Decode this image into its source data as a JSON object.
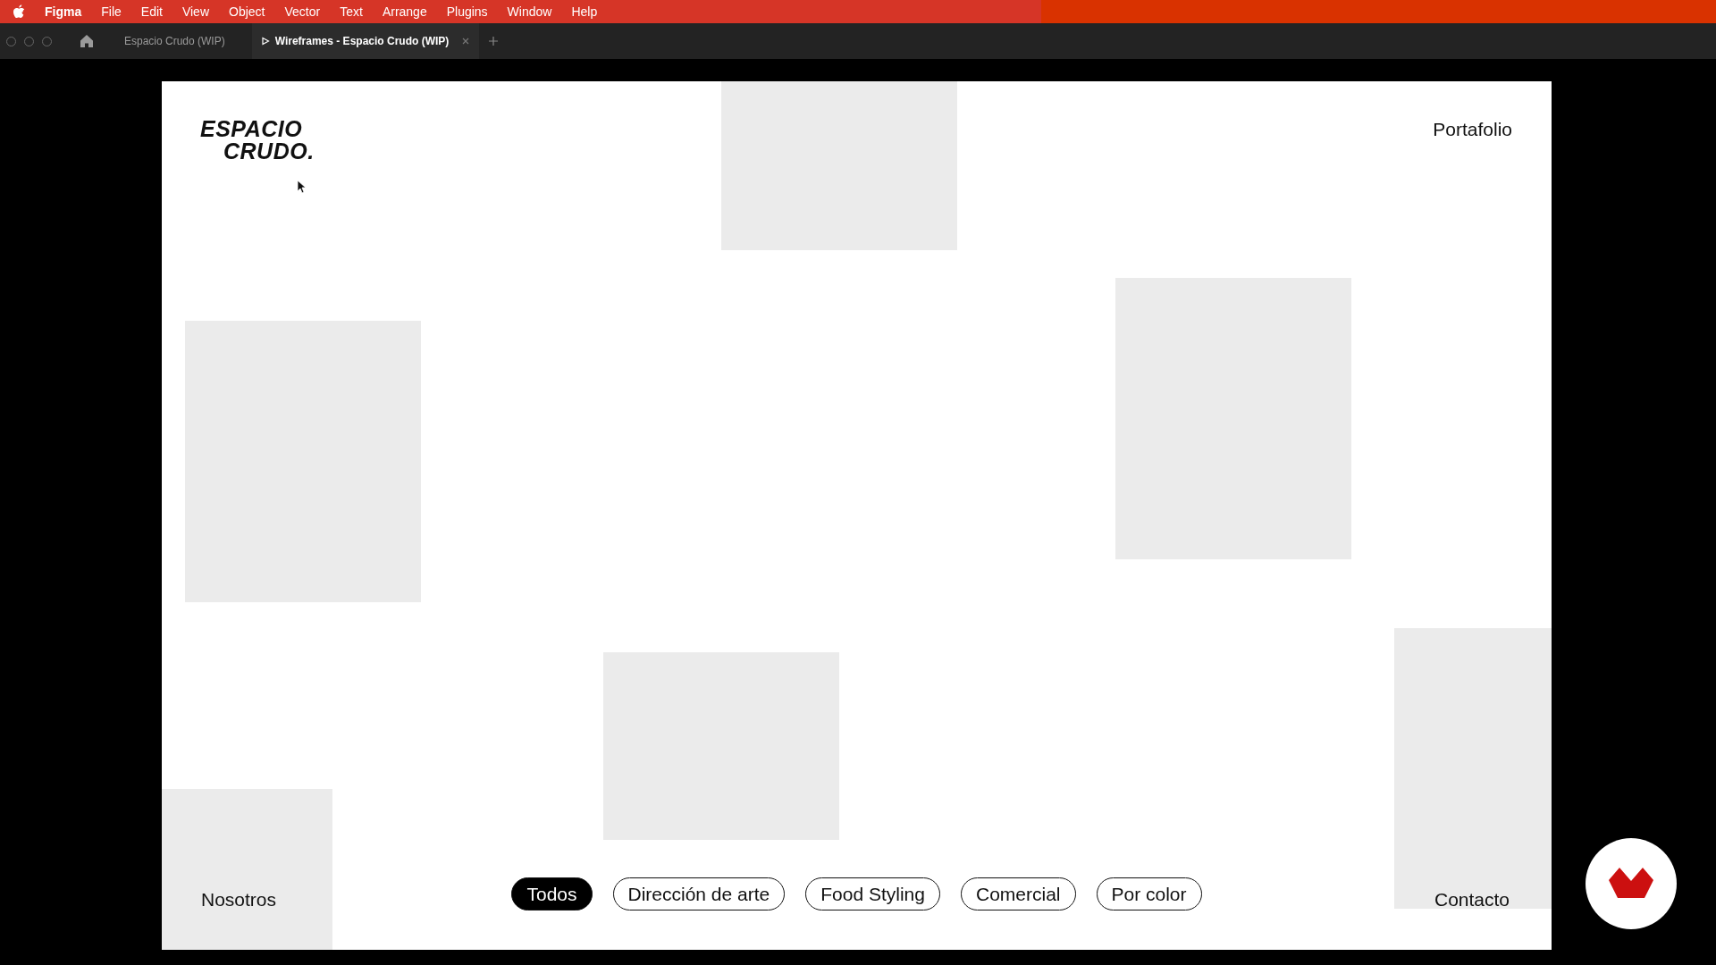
{
  "menu_bar": {
    "app_name": "Figma",
    "items": [
      "File",
      "Edit",
      "View",
      "Object",
      "Vector",
      "Text",
      "Arrange",
      "Plugins",
      "Window",
      "Help"
    ]
  },
  "tabs": [
    {
      "label": "Espacio Crudo (WIP)",
      "selected": false,
      "kind": "file"
    },
    {
      "label": "Wireframes - Espacio Crudo (WIP)",
      "selected": true,
      "kind": "prototype"
    }
  ],
  "frame": {
    "logo": [
      "ESPACIO",
      "CRUDO."
    ],
    "nav_top": "Portafolio",
    "nav_left": "Nosotros",
    "nav_right": "Contacto",
    "filters": [
      {
        "label": "Todos",
        "selected": true
      },
      {
        "label": "Dirección de arte",
        "selected": false
      },
      {
        "label": "Food Styling",
        "selected": false
      },
      {
        "label": "Comercial",
        "selected": false
      },
      {
        "label": "Por color",
        "selected": false
      }
    ]
  }
}
